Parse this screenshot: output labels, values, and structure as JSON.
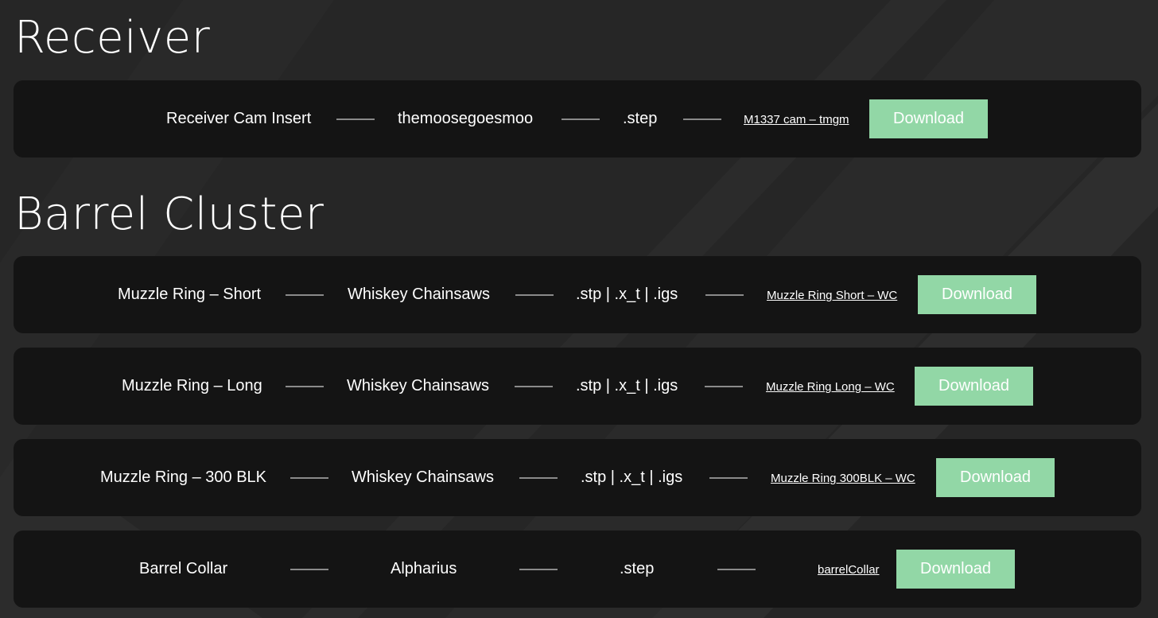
{
  "sections": [
    {
      "title": "Receiver",
      "rows": [
        {
          "part": "Receiver Cam Insert",
          "author": "themoosegoesmoo",
          "format": ".step",
          "file_link": "M1337 cam – tmgm",
          "button": "Download"
        }
      ]
    },
    {
      "title": "Barrel Cluster",
      "rows": [
        {
          "part": "Muzzle Ring – Short",
          "author": "Whiskey Chainsaws",
          "format": ".stp | .x_t | .igs",
          "file_link": "Muzzle Ring Short – WC",
          "button": "Download"
        },
        {
          "part": "Muzzle Ring – Long",
          "author": "Whiskey Chainsaws",
          "format": ".stp | .x_t | .igs",
          "file_link": "Muzzle Ring Long – WC",
          "button": "Download"
        },
        {
          "part": "Muzzle Ring – 300 BLK",
          "author": "Whiskey Chainsaws",
          "format": ".stp | .x_t | .igs",
          "file_link": "Muzzle Ring 300BLK – WC",
          "button": "Download"
        },
        {
          "part": "Barrel Collar",
          "author": "Alpharius",
          "format": ".step",
          "file_link": "barrelCollar",
          "button": "Download"
        }
      ]
    }
  ],
  "colors": {
    "background": "#262626",
    "card": "#141414",
    "button": "#92d7a6",
    "separator": "#8a8a8a",
    "text": "#ffffff"
  }
}
